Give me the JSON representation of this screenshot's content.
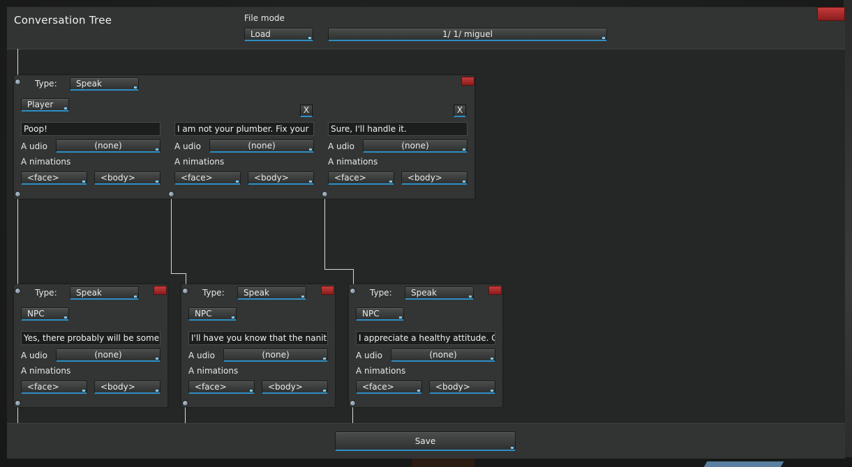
{
  "window": {
    "title": "Conversation Tree"
  },
  "header": {
    "file_mode_label": "File mode",
    "file_mode_value": "Load",
    "file_value": "1/ 1/ miguel"
  },
  "labels": {
    "type": "Type:",
    "audio": "A udio",
    "animations": "A nimations",
    "remove": "X"
  },
  "root_node": {
    "type_value": "Speak",
    "speaker": "Player",
    "responses": [
      {
        "text": "Poop!",
        "audio": "(none)",
        "face": "<face>",
        "body": "<body>"
      },
      {
        "text": "I am not your plumber. Fix your",
        "audio": "(none)",
        "face": "<face>",
        "body": "<body>"
      },
      {
        "text": "Sure, I'll handle it.",
        "audio": "(none)",
        "face": "<face>",
        "body": "<body>"
      }
    ]
  },
  "child_nodes": [
    {
      "type_value": "Speak",
      "speaker": "NPC",
      "text": "Yes, there probably will be some.",
      "audio": "(none)",
      "face": "<face>",
      "body": "<body>"
    },
    {
      "type_value": "Speak",
      "speaker": "NPC",
      "text": "I'll have you know that the nanites",
      "audio": "(none)",
      "face": "<face>",
      "body": "<body>"
    },
    {
      "type_value": "Speak",
      "speaker": "NPC",
      "text": "I appreciate a healthy attitude. Go",
      "audio": "(none)",
      "face": "<face>",
      "body": "<body>"
    }
  ],
  "footer": {
    "save_label": "Save"
  },
  "colors": {
    "accent": "#2f8fc6",
    "close": "#b03030",
    "panel": "#333534"
  }
}
